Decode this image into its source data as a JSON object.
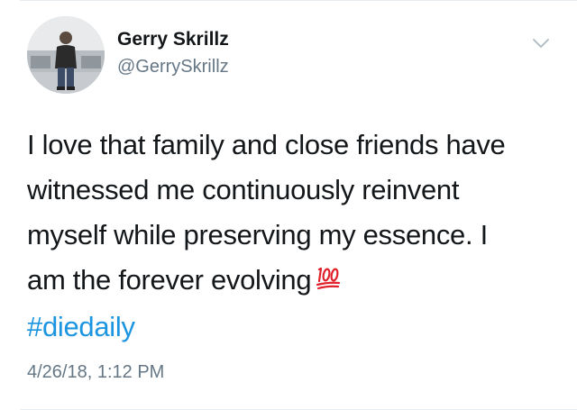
{
  "author": {
    "name": "Gerry Skrillz",
    "handle": "@GerrySkrillz"
  },
  "tweet": {
    "lines": [
      "I love that family and close friends have",
      "witnessed me continuously reinvent",
      "myself while preserving my essence. I",
      "am the forever evolving"
    ],
    "emoji": "hundred-points",
    "hashtag": "#diedaily",
    "timestamp": "4/26/18, 1:12 PM"
  },
  "icons": {
    "menu": "chevron-down-icon",
    "emoji": "hundred-points-icon"
  },
  "colors": {
    "text": "#14171a",
    "secondary": "#657786",
    "link": "#1b95e0",
    "emoji_red": "#e0202a"
  }
}
